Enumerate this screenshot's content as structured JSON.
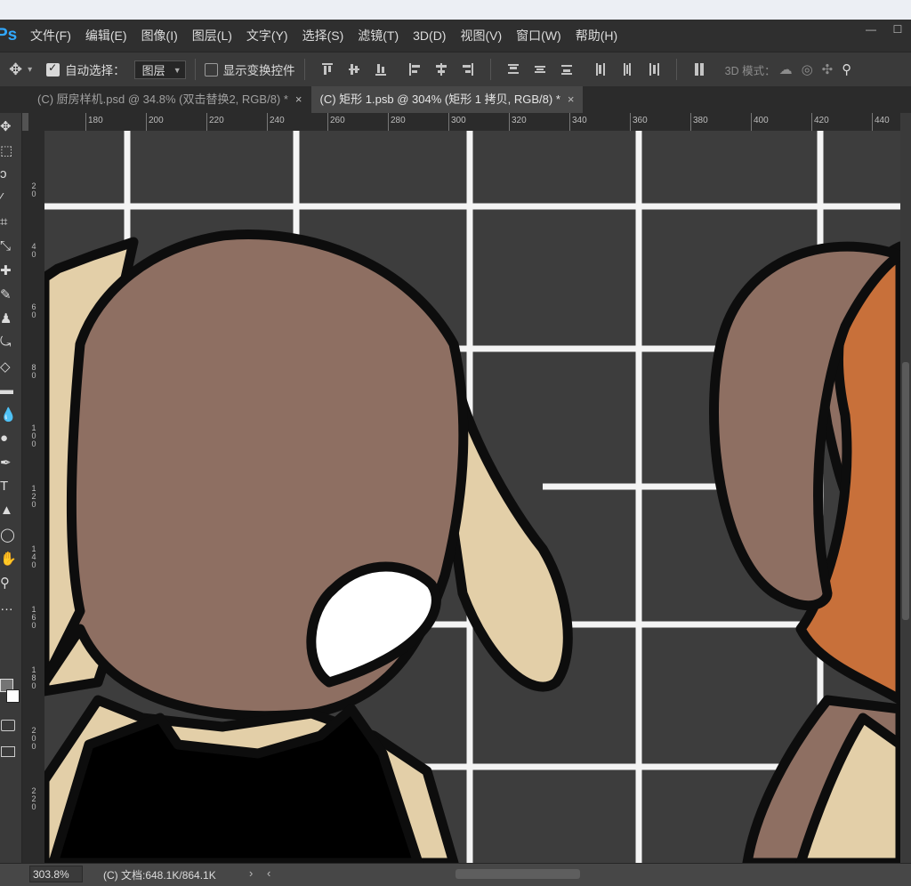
{
  "app": {
    "logo": "Ps"
  },
  "menu": [
    "文件(F)",
    "编辑(E)",
    "图像(I)",
    "图层(L)",
    "文字(Y)",
    "选择(S)",
    "滤镜(T)",
    "3D(D)",
    "视图(V)",
    "窗口(W)",
    "帮助(H)"
  ],
  "window_buttons": {
    "minimize": "—",
    "maximize": "☐"
  },
  "options": {
    "auto_select_label": "自动选择：",
    "auto_select_checked": true,
    "auto_select_target": "图层",
    "show_transform_label": "显示变换控件",
    "show_transform_checked": false,
    "mode_3d_label": "3D 模式："
  },
  "tabs": [
    {
      "label": "(C) 厨房样机.psd @ 34.8% (双击替换2, RGB/8) *",
      "active": false
    },
    {
      "label": "(C) 矩形 1.psb @ 304% (矩形 1 拷贝, RGB/8) *",
      "active": true
    }
  ],
  "tab_close": "×",
  "ruler": {
    "top_ticks": [
      "180",
      "200",
      "220",
      "240",
      "260",
      "280",
      "300",
      "320",
      "340",
      "360",
      "380",
      "400",
      "420",
      "440"
    ],
    "left_ticks": [
      "2\n0",
      "4\n0",
      "6\n0",
      "8\n0",
      "1\n0\n0",
      "1\n2\n0",
      "1\n4\n0",
      "1\n6\n0",
      "1\n8\n0",
      "2\n0\n0",
      "2\n2\n0"
    ]
  },
  "tools": [
    {
      "name": "move-tool",
      "glyph": "✥"
    },
    {
      "name": "marquee-tool",
      "glyph": "⬚"
    },
    {
      "name": "lasso-tool",
      "glyph": "ↄ"
    },
    {
      "name": "quick-select-tool",
      "glyph": "⁄"
    },
    {
      "name": "crop-tool",
      "glyph": "⌗"
    },
    {
      "name": "eyedropper-tool",
      "glyph": "⤡"
    },
    {
      "name": "healing-brush-tool",
      "glyph": "✚"
    },
    {
      "name": "brush-tool",
      "glyph": "✎"
    },
    {
      "name": "stamp-tool",
      "glyph": "♟"
    },
    {
      "name": "history-brush-tool",
      "glyph": "⤿"
    },
    {
      "name": "eraser-tool",
      "glyph": "◇"
    },
    {
      "name": "gradient-tool",
      "glyph": "▬"
    },
    {
      "name": "blur-tool",
      "glyph": "💧"
    },
    {
      "name": "dodge-tool",
      "glyph": "●"
    },
    {
      "name": "pen-tool",
      "glyph": "✒"
    },
    {
      "name": "type-tool",
      "glyph": "T"
    },
    {
      "name": "path-select-tool",
      "glyph": "▲"
    },
    {
      "name": "ellipse-tool",
      "glyph": "◯"
    },
    {
      "name": "hand-tool",
      "glyph": "✋"
    },
    {
      "name": "zoom-tool",
      "glyph": "⚲"
    },
    {
      "name": "more-tools",
      "glyph": "…"
    }
  ],
  "colors": {
    "foreground": "#757575",
    "background": "#ffffff",
    "canvas_bg": "#3d3d3d",
    "grid": "#f4f4f4",
    "skin": "#e3cfa8",
    "hair": "#8e6f62",
    "outline": "#0d0d0d",
    "shirt": "#000000",
    "orange": "#c8703a"
  },
  "status": {
    "zoom": "303.8%",
    "doc_info": "(C) 文档:648.1K/864.1K",
    "arrow_right": "›",
    "arrow_left": "‹"
  }
}
